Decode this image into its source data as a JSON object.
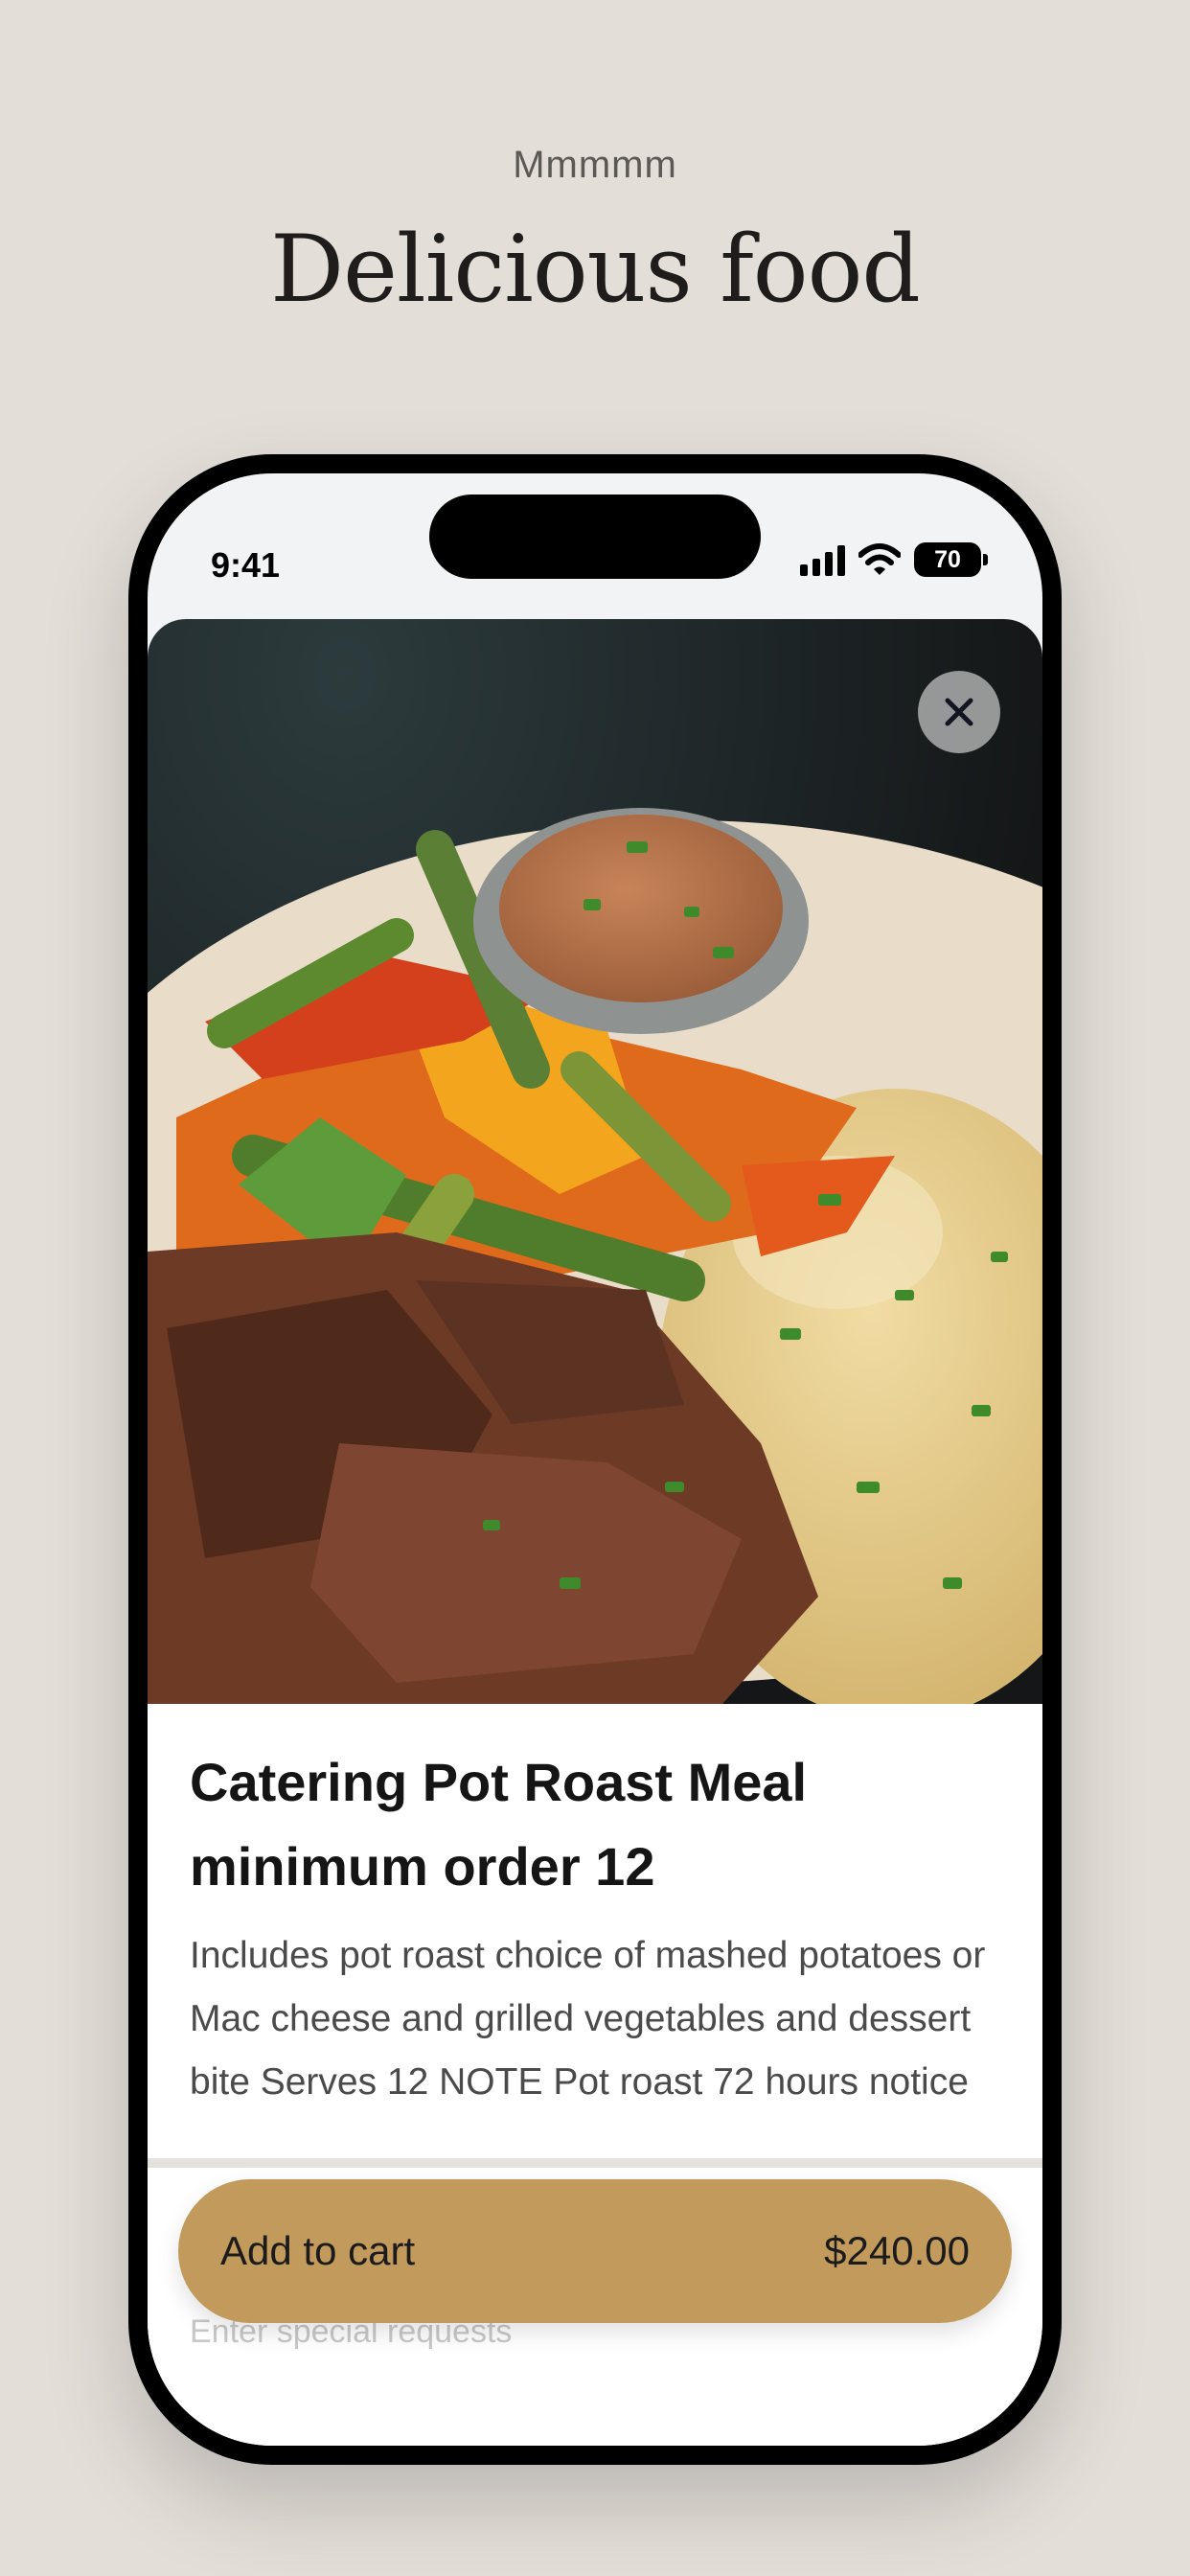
{
  "header": {
    "kicker": "Mmmmm",
    "headline": "Delicious food"
  },
  "status_bar": {
    "time": "9:41",
    "battery": "70"
  },
  "item": {
    "title": "Catering Pot Roast Meal minimum order 12",
    "description": "Includes pot roast choice of mashed potatoes or Mac cheese and grilled vegetables and dessert bite Serves 12 NOTE Pot roast 72 hours notice"
  },
  "footer": {
    "hint": "Enter special requests",
    "add_to_cart": "Add to cart",
    "price": "$240.00"
  },
  "colors": {
    "accent": "#c29a5c",
    "background": "#e3ded8"
  },
  "icons": [
    "close-icon",
    "cellular-signal-icon",
    "wifi-icon",
    "battery-icon"
  ]
}
